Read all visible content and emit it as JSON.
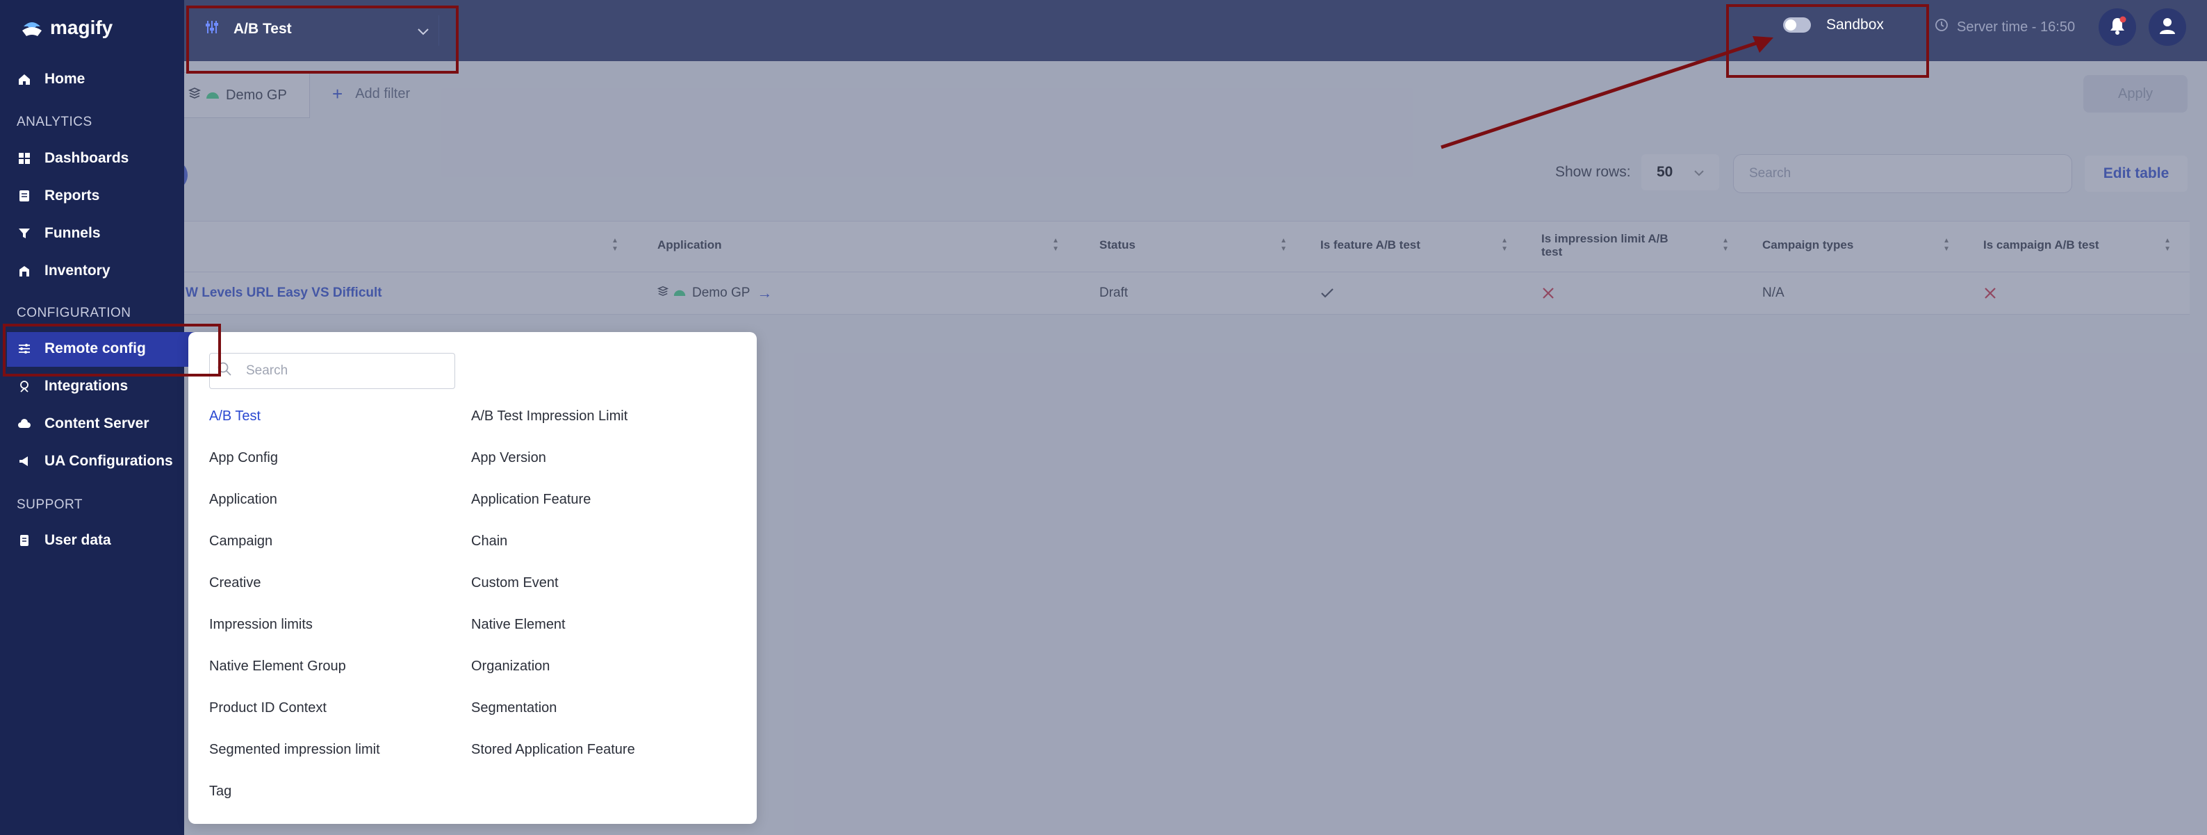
{
  "app": {
    "name": "magify"
  },
  "header": {
    "selector_label": "A/B Test",
    "sandbox_label": "Sandbox",
    "server_time": "Server time - 16:50"
  },
  "sidebar": {
    "home": "Home",
    "analytics_section": "ANALYTICS",
    "analytics": [
      "Dashboards",
      "Reports",
      "Funnels",
      "Inventory"
    ],
    "configuration_section": "CONFIGURATION",
    "configuration": [
      "Remote config",
      "Integrations",
      "Content Server",
      "UA Configurations"
    ],
    "support_section": "SUPPORT",
    "support": [
      "User data"
    ]
  },
  "filters": {
    "chip_label": "Demo GP",
    "add_filter": "Add filter",
    "apply": "Apply"
  },
  "table_controls": {
    "show_rows_label": "Show rows:",
    "rows_value": "50",
    "search_placeholder": "Search",
    "edit_table": "Edit table"
  },
  "table": {
    "columns": [
      "Application",
      "Status",
      "Is feature A/B test",
      "Is impression limit A/B test",
      "Campaign types",
      "Is campaign A/B test"
    ],
    "row": {
      "name": "W Levels URL Easy VS Difficult",
      "application": "Demo GP",
      "status": "Draft",
      "campaign_types": "N/A"
    }
  },
  "popup": {
    "search_placeholder": "Search",
    "left": [
      "A/B Test",
      "App Config",
      "Application",
      "Campaign",
      "Creative",
      "Impression limits",
      "Native Element Group",
      "Product ID Context",
      "Segmented impression limit",
      "Tag"
    ],
    "right": [
      "A/B Test Impression Limit",
      "App Version",
      "Application Feature",
      "Chain",
      "Custom Event",
      "Native Element",
      "Organization",
      "Segmentation",
      "Stored Application Feature"
    ],
    "selected": "A/B Test"
  },
  "colors": {
    "header": "#1f2b5e",
    "sidebar": "#1a2553",
    "accent": "#2b49d1",
    "highlight": "#7a0e12"
  }
}
